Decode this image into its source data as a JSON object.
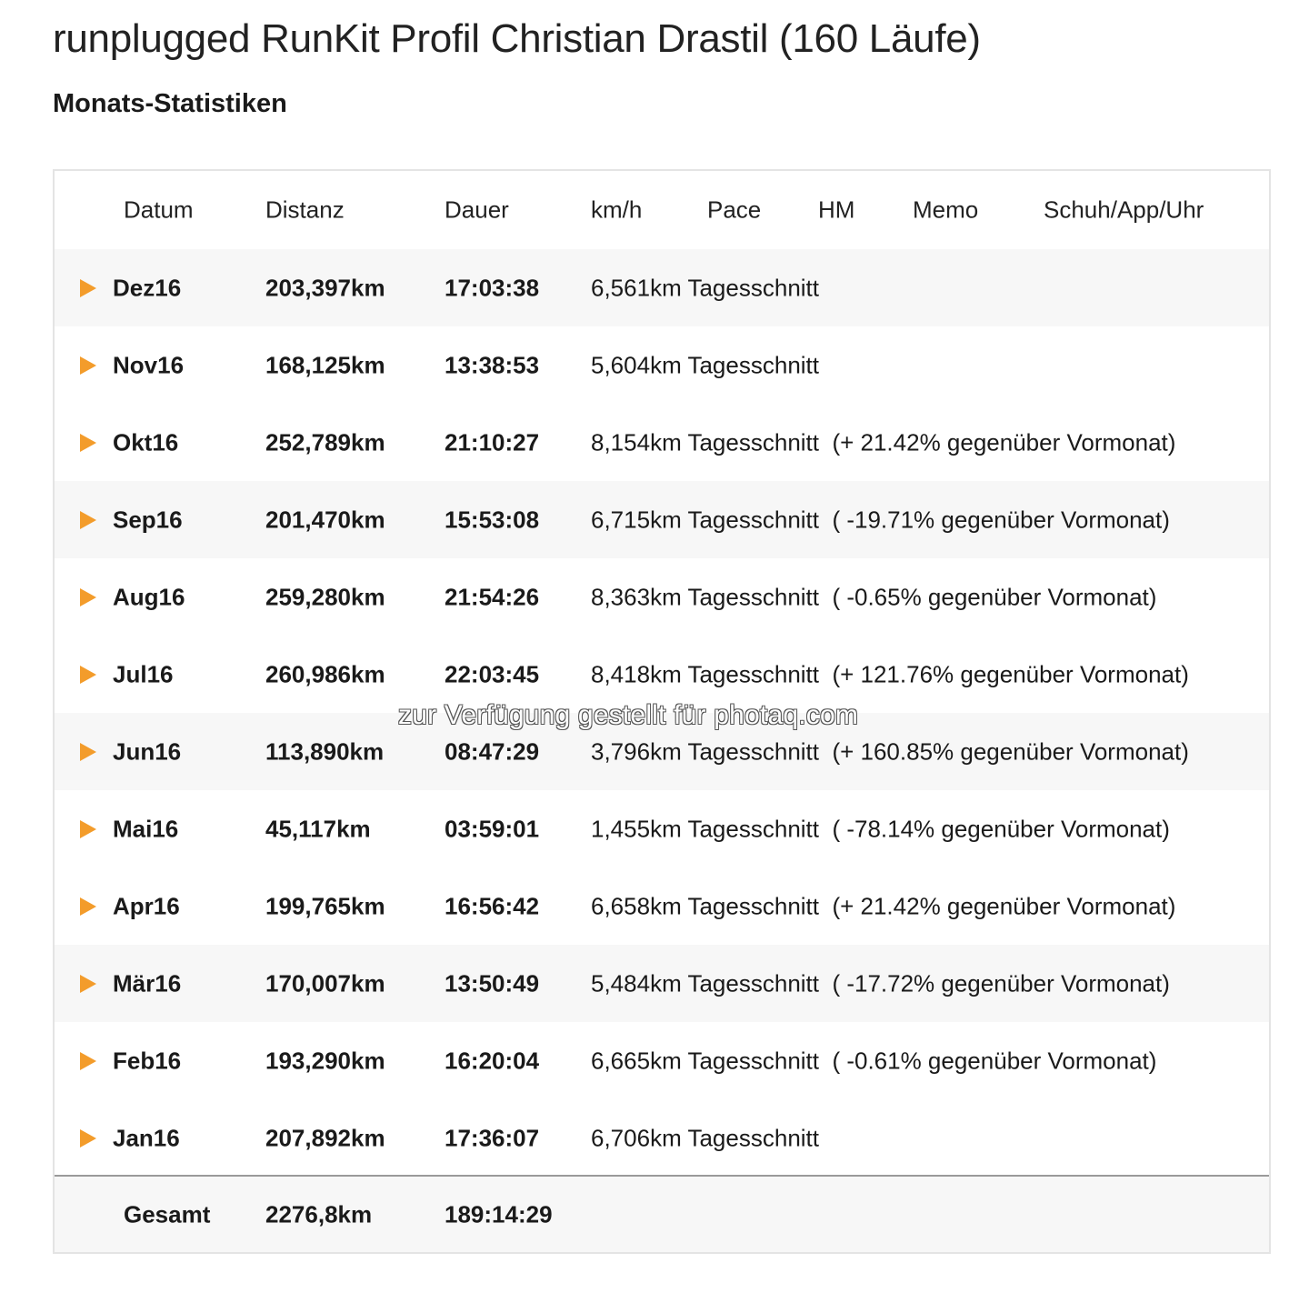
{
  "title": "runplugged RunKit Profil Christian Drastil (160 Läufe)",
  "subtitle": "Monats-Statistiken",
  "columns": [
    "Datum",
    "Distanz",
    "Dauer",
    "km/h",
    "Pace",
    "HM",
    "Memo",
    "Schuh/App/Uhr"
  ],
  "rows": [
    {
      "month": "Dez16",
      "distance": "203,397km",
      "duration": "17:03:38",
      "info": "6,561km Tagesschnitt"
    },
    {
      "month": "Nov16",
      "distance": "168,125km",
      "duration": "13:38:53",
      "info": "5,604km Tagesschnitt"
    },
    {
      "month": "Okt16",
      "distance": "252,789km",
      "duration": "21:10:27",
      "info": "8,154km Tagesschnitt  (+ 21.42% gegenüber Vormonat)"
    },
    {
      "month": "Sep16",
      "distance": "201,470km",
      "duration": "15:53:08",
      "info": "6,715km Tagesschnitt  ( -19.71% gegenüber Vormonat)"
    },
    {
      "month": "Aug16",
      "distance": "259,280km",
      "duration": "21:54:26",
      "info": "8,363km Tagesschnitt  ( -0.65% gegenüber Vormonat)"
    },
    {
      "month": "Jul16",
      "distance": "260,986km",
      "duration": "22:03:45",
      "info": "8,418km Tagesschnitt  (+ 121.76% gegenüber Vormonat)"
    },
    {
      "month": "Jun16",
      "distance": "113,890km",
      "duration": "08:47:29",
      "info": "3,796km Tagesschnitt  (+ 160.85% gegenüber Vormonat)"
    },
    {
      "month": "Mai16",
      "distance": "45,117km",
      "duration": "03:59:01",
      "info": "1,455km Tagesschnitt  ( -78.14% gegenüber Vormonat)"
    },
    {
      "month": "Apr16",
      "distance": "199,765km",
      "duration": "16:56:42",
      "info": "6,658km Tagesschnitt  (+ 21.42% gegenüber Vormonat)"
    },
    {
      "month": "Mär16",
      "distance": "170,007km",
      "duration": "13:50:49",
      "info": "5,484km Tagesschnitt  ( -17.72% gegenüber Vormonat)"
    },
    {
      "month": "Feb16",
      "distance": "193,290km",
      "duration": "16:20:04",
      "info": "6,665km Tagesschnitt  ( -0.61% gegenüber Vormonat)"
    },
    {
      "month": "Jan16",
      "distance": "207,892km",
      "duration": "17:36:07",
      "info": "6,706km Tagesschnitt"
    }
  ],
  "total": {
    "label": "Gesamt",
    "distance": "2276,8km",
    "duration": "189:14:29"
  },
  "watermark": "zur Verfügung gestellt für photaq.com",
  "colors": {
    "accent_arrow": "#f39c2b",
    "row_shade": "#f7f7f7",
    "border": "#e4e4e4"
  },
  "icons": {
    "expand_row": "triangle-right-icon"
  }
}
